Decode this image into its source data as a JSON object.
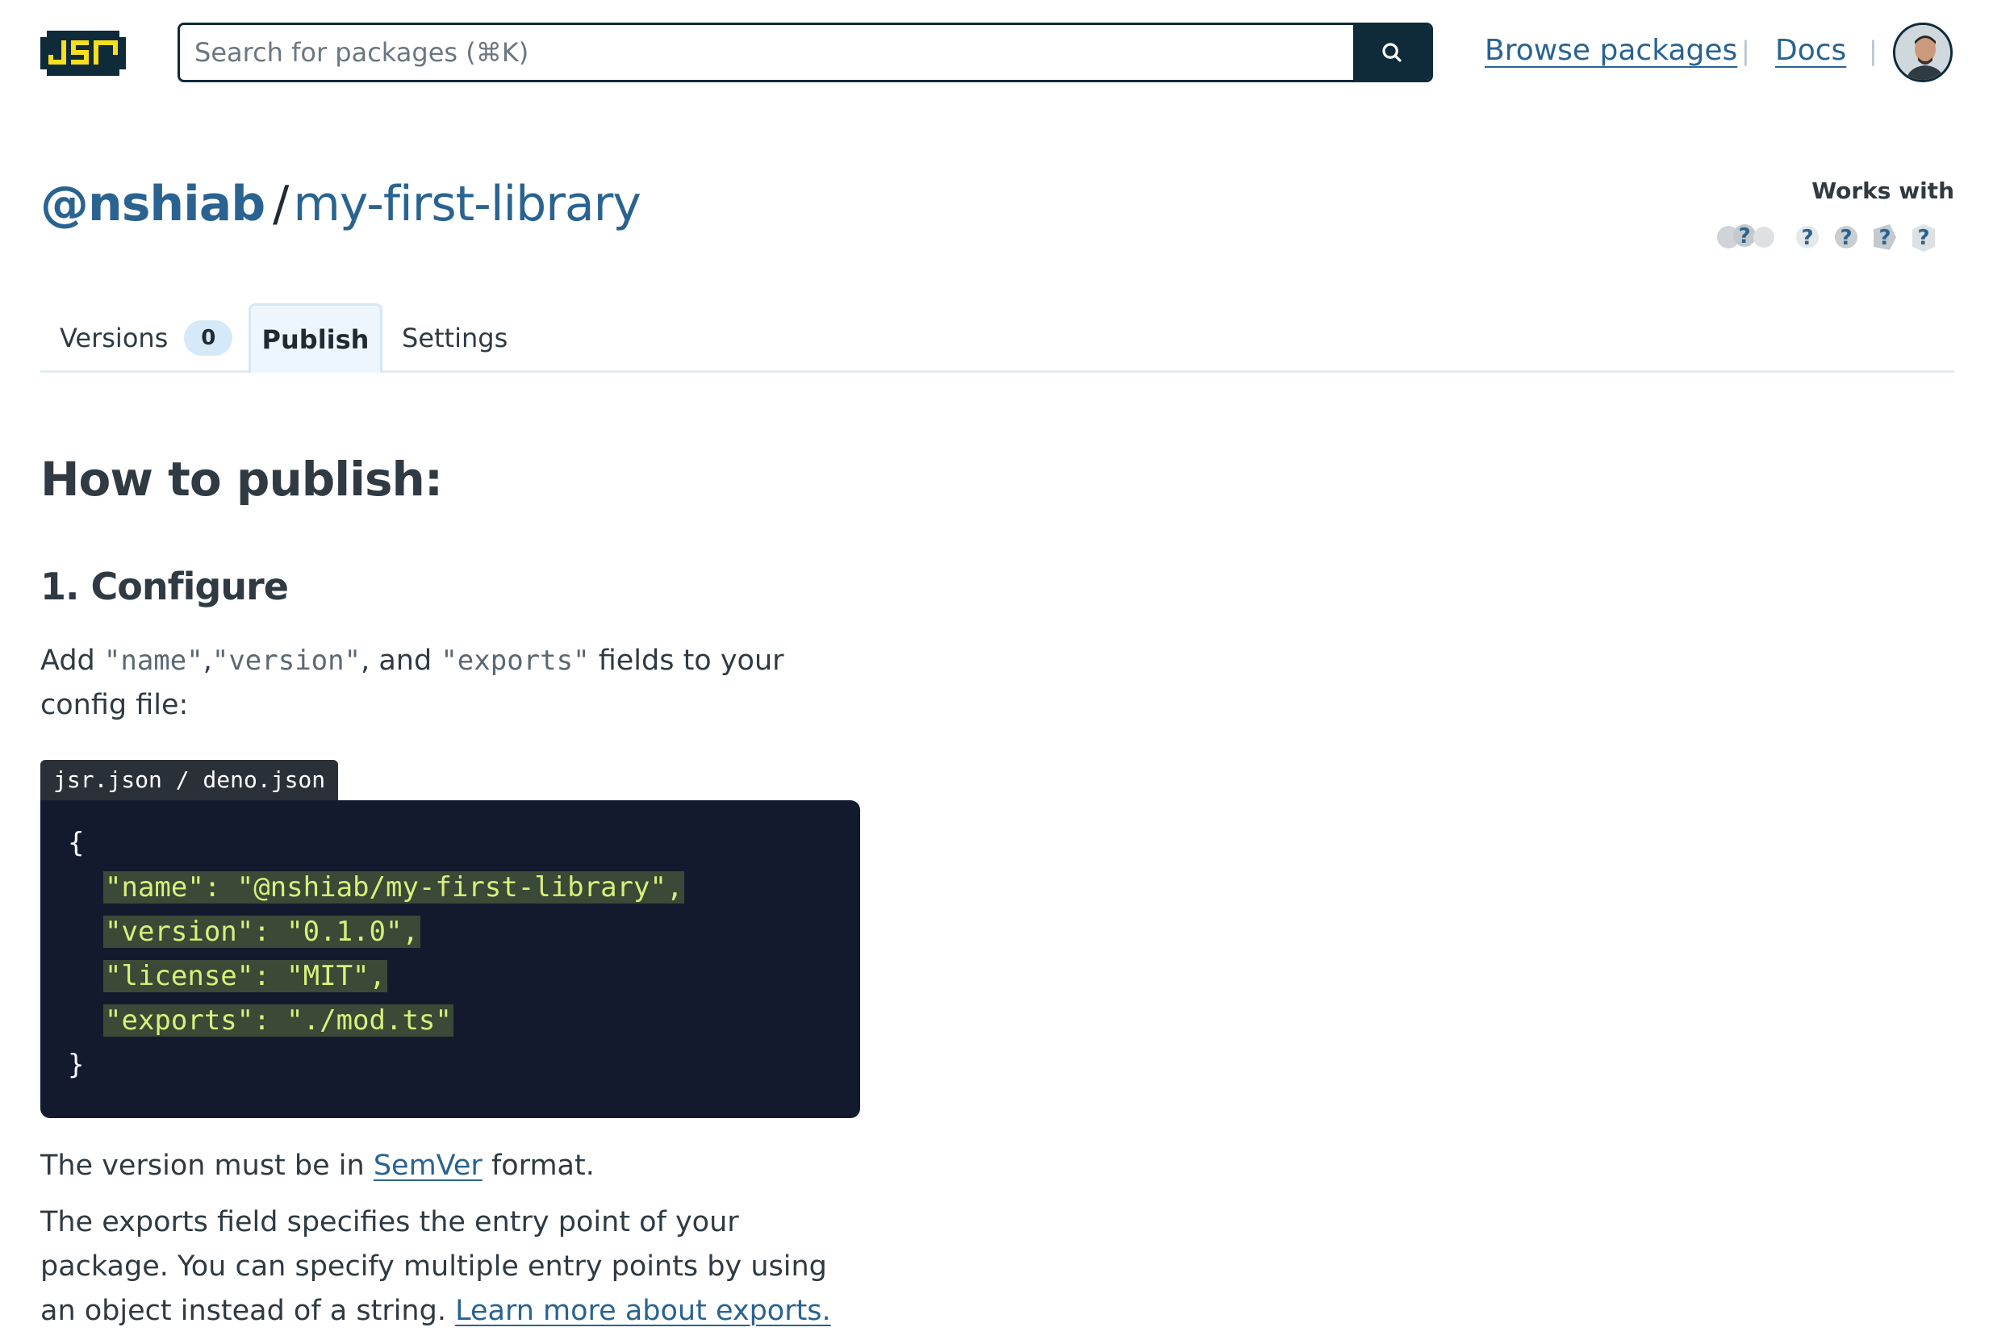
{
  "header": {
    "search_placeholder": "Search for packages (⌘K)",
    "nav": {
      "browse": "Browse packages",
      "separator": "|",
      "docs": "Docs"
    }
  },
  "package": {
    "scope": "@nshiab",
    "slash": "/",
    "name": "my-first-library",
    "works_with_label": "Works with"
  },
  "tabs": {
    "versions_label": "Versions",
    "versions_count": "0",
    "publish_label": "Publish",
    "settings_label": "Settings"
  },
  "content": {
    "heading": "How to publish:",
    "step1": "1. Configure",
    "add_text": {
      "part1": "Add ",
      "name": "\"name\"",
      "comma1": ",",
      "version": "\"version\"",
      "part2": ", and ",
      "exports": "\"exports\"",
      "part3": " fields to your config file:"
    },
    "code_tab": "jsr.json / deno.json",
    "code_lines": {
      "open": "{",
      "l1": "\"name\": \"@nshiab/my-first-library\",",
      "l2": "\"version\": \"0.1.0\",",
      "l3": "\"license\": \"MIT\",",
      "l4": "\"exports\": \"./mod.ts\"",
      "close": "}"
    },
    "semver": {
      "before": "The version must be in ",
      "link": "SemVer",
      "after": " format."
    },
    "exports_para": {
      "text": "The exports field specifies the entry point of your package. You can specify multiple entry points by using an object instead of a string. ",
      "link": "Learn more about exports."
    }
  },
  "colors": {
    "brand": "#2a6390",
    "dark": "#0f2b3a",
    "code_bg": "#131a2e",
    "code_highlight": "#d8f07c"
  },
  "icons": [
    "jsr-logo",
    "search-icon",
    "avatar",
    "runtime-deno-icon",
    "runtime-node-icon",
    "runtime-cloudflare-icon",
    "runtime-bun-icon",
    "runtime-browser-icon"
  ]
}
